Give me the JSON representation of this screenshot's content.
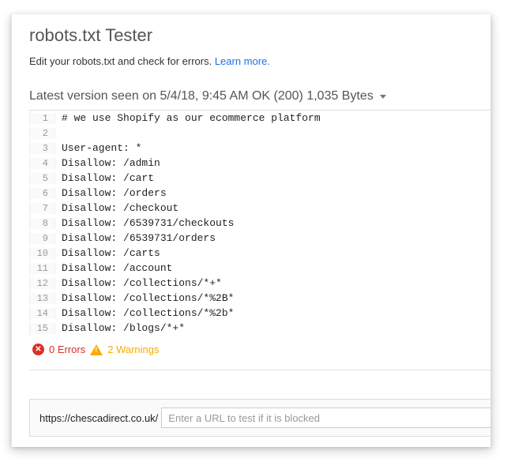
{
  "title": "robots.txt Tester",
  "subtitle_text": "Edit your robots.txt and check for errors. ",
  "learn_more": "Learn more.",
  "version_bar": "Latest version seen on 5/4/18, 9:45 AM OK (200) 1,035 Bytes",
  "lines": [
    {
      "n": "1",
      "t": "# we use Shopify as our ecommerce platform"
    },
    {
      "n": "2",
      "t": ""
    },
    {
      "n": "3",
      "t": "User-agent: *"
    },
    {
      "n": "4",
      "t": "Disallow: /admin"
    },
    {
      "n": "5",
      "t": "Disallow: /cart"
    },
    {
      "n": "6",
      "t": "Disallow: /orders"
    },
    {
      "n": "7",
      "t": "Disallow: /checkout"
    },
    {
      "n": "8",
      "t": "Disallow: /6539731/checkouts"
    },
    {
      "n": "9",
      "t": "Disallow: /6539731/orders"
    },
    {
      "n": "10",
      "t": "Disallow: /carts"
    },
    {
      "n": "11",
      "t": "Disallow: /account"
    },
    {
      "n": "12",
      "t": "Disallow: /collections/*+*"
    },
    {
      "n": "13",
      "t": "Disallow: /collections/*%2B*"
    },
    {
      "n": "14",
      "t": "Disallow: /collections/*%2b*"
    },
    {
      "n": "15",
      "t": "Disallow: /blogs/*+*"
    }
  ],
  "status": {
    "errors_label": "0 Errors",
    "warnings_label": "2 Warnings"
  },
  "url_prefix": "https://chescadirect.co.uk/",
  "url_placeholder": "Enter a URL to test if it is blocked"
}
